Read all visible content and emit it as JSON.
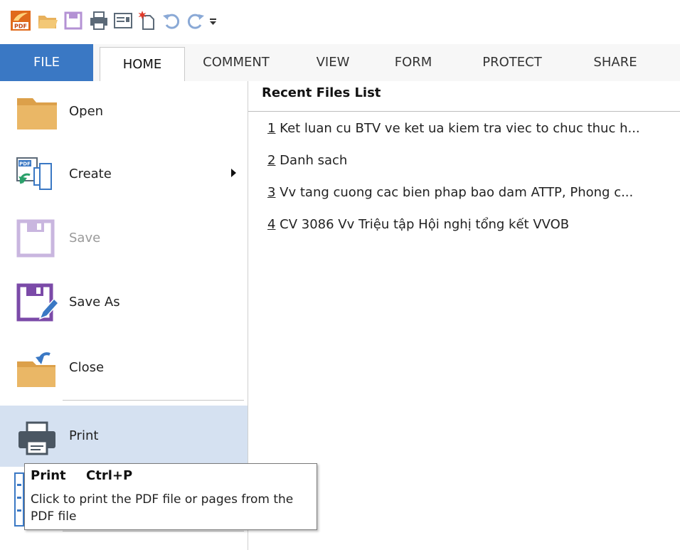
{
  "tabs": {
    "file": "FILE",
    "home": "HOME",
    "comment": "COMMENT",
    "view": "VIEW",
    "form": "FORM",
    "protect": "PROTECT",
    "share": "SHARE"
  },
  "menu": {
    "open": "Open",
    "create": "Create",
    "save": "Save",
    "save_as": "Save As",
    "close": "Close",
    "print": "Print"
  },
  "recent": {
    "title": "Recent Files List",
    "items": [
      {
        "num": "1",
        "label": " Ket luan cu BTV ve ket ua kiem tra viec to chuc thuc h..."
      },
      {
        "num": "2",
        "label": " Danh sach"
      },
      {
        "num": "3",
        "label": " Vv tang cuong cac bien phap bao dam ATTP, Phong c..."
      },
      {
        "num": "4",
        "label": " CV 3086 Vv Triệu tập Hội nghị tổng kết VVOB"
      }
    ]
  },
  "tooltip": {
    "title": "Print",
    "shortcut": "Ctrl+P",
    "description": "Click to print the PDF file or pages from the PDF file"
  },
  "colors": {
    "file_tab": "#3a78c4",
    "selected_item": "#d5e1f1",
    "folder": "#e8b15c",
    "save_purple": "#7b4aa8"
  }
}
